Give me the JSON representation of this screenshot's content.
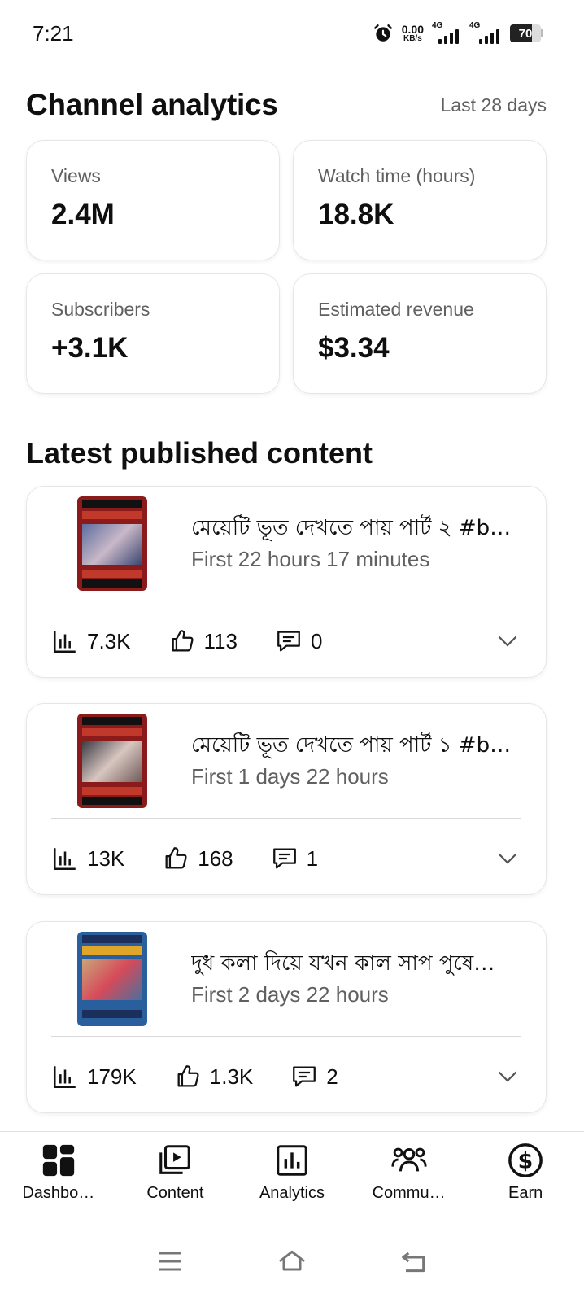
{
  "status_bar": {
    "time": "7:21",
    "net_speed_value": "0.00",
    "net_speed_unit": "KB/s",
    "sim1_tag": "4G",
    "sim2_tag": "4G",
    "battery_level": "70",
    "battery_fraction": 0.7
  },
  "header": {
    "title": "Channel analytics",
    "period": "Last 28 days"
  },
  "metrics": [
    {
      "label": "Views",
      "value": "2.4M"
    },
    {
      "label": "Watch time (hours)",
      "value": "18.8K"
    },
    {
      "label": "Subscribers",
      "value": "+3.1K"
    },
    {
      "label": "Estimated revenue",
      "value": "$3.34"
    }
  ],
  "latest": {
    "title": "Latest published content",
    "items": [
      {
        "title": "মেয়েটি ভূত দেখতে পায় পার্ট ২ #b…",
        "age": "First 22 hours 17 minutes",
        "views": "7.3K",
        "likes": "113",
        "comments": "0",
        "thumb_color": "#8b1a1a"
      },
      {
        "title": "মেয়েটি ভূত দেখতে পায় পার্ট ১ #b…",
        "age": "First 1 days 22 hours",
        "views": "13K",
        "likes": "168",
        "comments": "1",
        "thumb_color": "#8b1a1a"
      },
      {
        "title": "দুধ কলা দিয়ে যখন কাল সাপ পুষে…",
        "age": "First 2 days 22 hours",
        "views": "179K",
        "likes": "1.3K",
        "comments": "2",
        "thumb_color": "#2a5f9e"
      }
    ]
  },
  "bottom_nav": [
    {
      "label": "Dashbo…",
      "icon": "dashboard-icon"
    },
    {
      "label": "Content",
      "icon": "content-icon"
    },
    {
      "label": "Analytics",
      "icon": "analytics-icon"
    },
    {
      "label": "Commu…",
      "icon": "community-icon"
    },
    {
      "label": "Earn",
      "icon": "earn-icon"
    }
  ],
  "colors": {
    "text_primary": "#0f0f0f",
    "text_secondary": "#606060",
    "divider": "#d9d9d9"
  }
}
